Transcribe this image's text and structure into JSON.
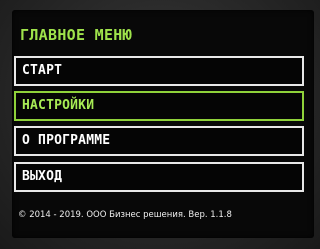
{
  "menu": {
    "title": "ГЛАВНОЕ МЕНЮ",
    "items": [
      {
        "label": "СТАРТ",
        "selected": false
      },
      {
        "label": "НАСТРОЙКИ",
        "selected": true
      },
      {
        "label": "О ПРОГРАММЕ",
        "selected": false
      },
      {
        "label": "ВЫХОД",
        "selected": false
      }
    ]
  },
  "footer": {
    "text": "© 2014 - 2019. ООО Бизнес решения. Вер. 1.1.8"
  },
  "colors": {
    "title": "#9fe34b",
    "selected_border": "#8fd23a",
    "normal_border": "#e8e8e8",
    "background": "#080808"
  }
}
